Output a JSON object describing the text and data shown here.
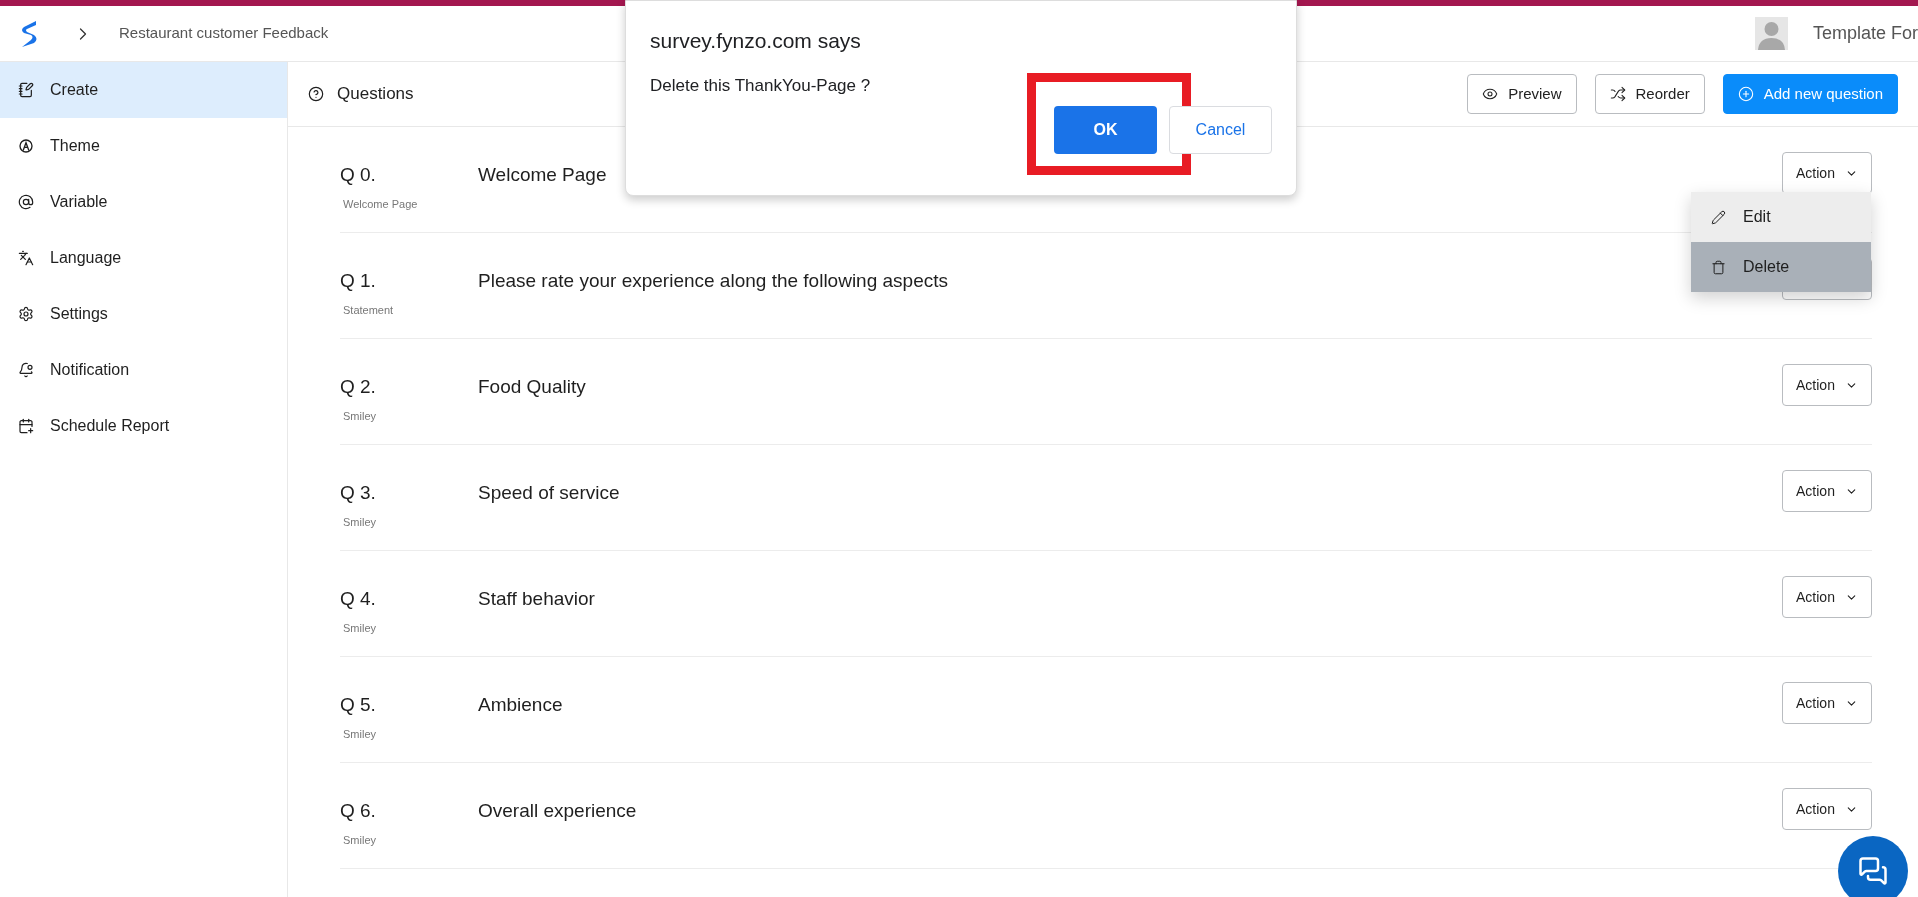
{
  "top_bar": {
    "breadcrumb": "Restaurant customer Feedback",
    "account_name": "Template For"
  },
  "sidebar": {
    "items": [
      {
        "label": "Create",
        "kind": "create",
        "selected": true
      },
      {
        "label": "Theme",
        "kind": "theme",
        "selected": false
      },
      {
        "label": "Variable",
        "kind": "variable",
        "selected": false
      },
      {
        "label": "Language",
        "kind": "language",
        "selected": false
      },
      {
        "label": "Settings",
        "kind": "settings",
        "selected": false
      },
      {
        "label": "Notification",
        "kind": "notification",
        "selected": false
      },
      {
        "label": "Schedule Report",
        "kind": "schedule",
        "selected": false
      }
    ]
  },
  "toolbar": {
    "title": "Questions",
    "buttons": [
      {
        "label": "Preview",
        "kind": "preview"
      },
      {
        "label": "Reorder",
        "kind": "reorder"
      },
      {
        "label": "Add new question",
        "kind": "add"
      }
    ]
  },
  "questions": [
    {
      "number": "Q 0.",
      "title": "Welcome Page",
      "type": "Welcome Page",
      "action": "Action"
    },
    {
      "number": "Q 1.",
      "title": "Please rate your experience along the following aspects",
      "type": "Statement"
    },
    {
      "number": "Q 2.",
      "title": "Food Quality",
      "type": "Smiley",
      "action": "Action"
    },
    {
      "number": "Q 3.",
      "title": "Speed of service",
      "type": "Smiley",
      "action": "Action"
    },
    {
      "number": "Q 4.",
      "title": "Staff behavior",
      "type": "Smiley",
      "action": "Action"
    },
    {
      "number": "Q 5.",
      "title": "Ambience",
      "type": "Smiley",
      "action": "Action"
    },
    {
      "number": "Q 6.",
      "title": "Overall experience",
      "type": "Smiley",
      "action": "Action"
    }
  ],
  "action_menu": {
    "items": [
      {
        "label": "Edit",
        "kind": "edit",
        "selected": false
      },
      {
        "label": "Delete",
        "kind": "delete",
        "selected": true
      }
    ]
  },
  "dialog": {
    "title": "survey.fynzo.com says",
    "message": "Delete this ThankYou-Page ?",
    "buttons": [
      {
        "label": "OK",
        "kind": "primary",
        "highlighted": true
      },
      {
        "label": "Cancel",
        "kind": "secondary",
        "highlighted": false
      }
    ]
  }
}
